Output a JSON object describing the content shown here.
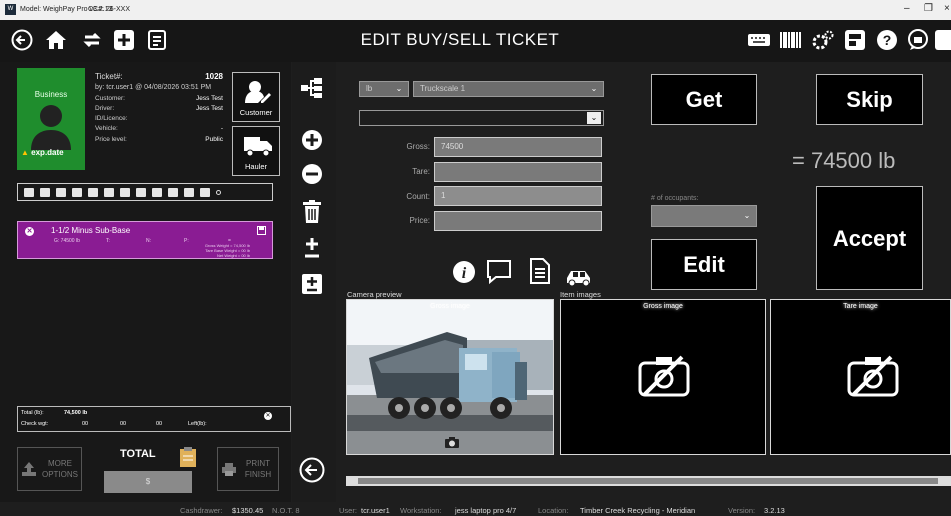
{
  "window": {
    "title": "Model: WeighPay Pro v3.2.13",
    "cc": "CC#: 26-XXX"
  },
  "header": {
    "title": "EDIT BUY/SELL TICKET"
  },
  "ticket": {
    "business_label": "Business",
    "exp_label": "exp.date",
    "ticket_label": "Ticket#:",
    "ticket_no": "1028",
    "by_line": "by: tcr.user1 @ 04/08/2026 03:51 PM",
    "rows": [
      {
        "label": "Customer:",
        "value": "Jess Test"
      },
      {
        "label": "Driver:",
        "value": "Jess Test"
      },
      {
        "label": "ID/Licence:",
        "value": ""
      },
      {
        "label": "Vehicle:",
        "value": "-"
      },
      {
        "label": "Price level:",
        "value": "Public"
      }
    ],
    "customer_btn": "Customer",
    "hauler_btn": "Hauler"
  },
  "item": {
    "name": "1-1/2 Minus Sub-Base",
    "g": "G: 74500 lb",
    "t": "T:",
    "n": "N:",
    "p": "P:",
    "eq": "=",
    "gross_weight": "Gross Weight = 74,500  lb",
    "tare_weight": "Tare Base Weight =      00  lb",
    "net_weight": "Net Weight =      00  lb"
  },
  "totals": {
    "total_lb_label": "Total (lb):",
    "total_lb_value": "74,500 lb",
    "check_label": "Check wgt:",
    "check_v1": "00",
    "check_v2": "00",
    "check_v3": "00",
    "left_label": "Left(lb):"
  },
  "bottom": {
    "more_options": "MORE OPTIONS",
    "total": "TOTAL",
    "dollar": "$",
    "print_finish": "PRINT FINISH"
  },
  "scale": {
    "unit": "lb",
    "scale_name": "Truckscale 1",
    "product_select": ""
  },
  "fields": {
    "gross_label": "Gross:",
    "gross_value": "74500",
    "tare_label": "Tare:",
    "tare_value": "",
    "count_label": "Count:",
    "count_value": "1",
    "price_label": "Price:",
    "price_value": ""
  },
  "actions": {
    "get": "Get",
    "skip": "Skip",
    "accept": "Accept",
    "edit": "Edit"
  },
  "readout": "= 74500 lb",
  "occupants": {
    "label": "# of occupants:",
    "value": ""
  },
  "images": {
    "camera_preview": "Camera preview",
    "item_images": "Item images",
    "gross_tag": "Gross image",
    "gross_tag2": "Gross image",
    "tare_tag": "Tare image"
  },
  "status": {
    "cashdrawer_label": "Cashdrawer:",
    "cashdrawer_value": "$1350.45",
    "not": "N.O.T. 8",
    "user_label": "User:",
    "user_value": "tcr.user1",
    "ws_label": "Workstation:",
    "ws_value": "jess laptop pro 4/7",
    "loc_label": "Location:",
    "loc_value": "Timber Creek Recycling - Meridian",
    "ver_label": "Version:",
    "ver_value": "3.2.13"
  }
}
